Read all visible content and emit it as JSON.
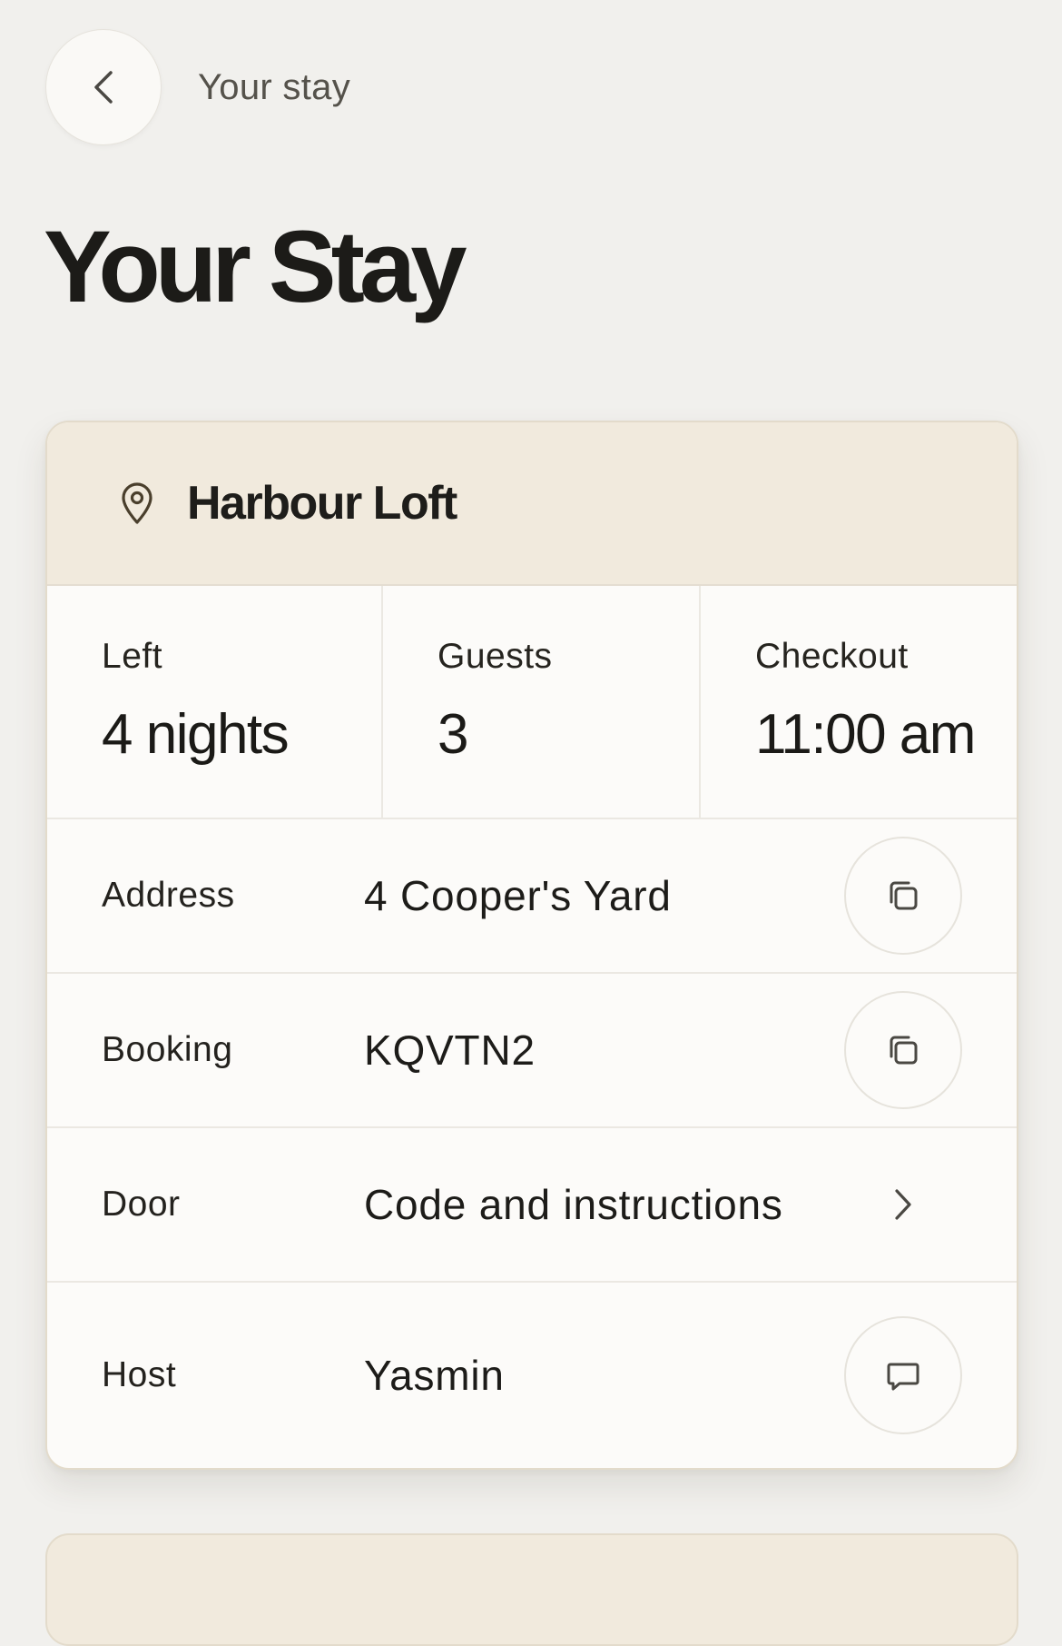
{
  "topbar": {
    "title": "Your stay",
    "back_icon": "chevron-left-icon"
  },
  "page": {
    "title": "Your Stay"
  },
  "stay_card": {
    "property_name": "Harbour Loft",
    "property_icon": "map-pin-icon",
    "stats": [
      {
        "label": "Left",
        "value": "4 nights"
      },
      {
        "label": "Guests",
        "value": "3"
      },
      {
        "label": "Checkout",
        "value": "11:00 am"
      }
    ],
    "rows": [
      {
        "label": "Address",
        "value": "4 Cooper's Yard",
        "action_icon": "copy-icon"
      },
      {
        "label": "Booking",
        "value": "KQVTN2",
        "action_icon": "copy-icon"
      },
      {
        "label": "Door",
        "value": "Code and instructions",
        "action_icon": "chevron-right-icon"
      },
      {
        "label": "Host",
        "value": "Yasmin",
        "action_icon": "message-icon"
      }
    ]
  },
  "colors": {
    "background": "#f1f0ed",
    "card_header": "#f1eadd",
    "card_body": "#fcfbf9",
    "text_primary": "#1d1c19",
    "text_muted": "#55524b"
  }
}
